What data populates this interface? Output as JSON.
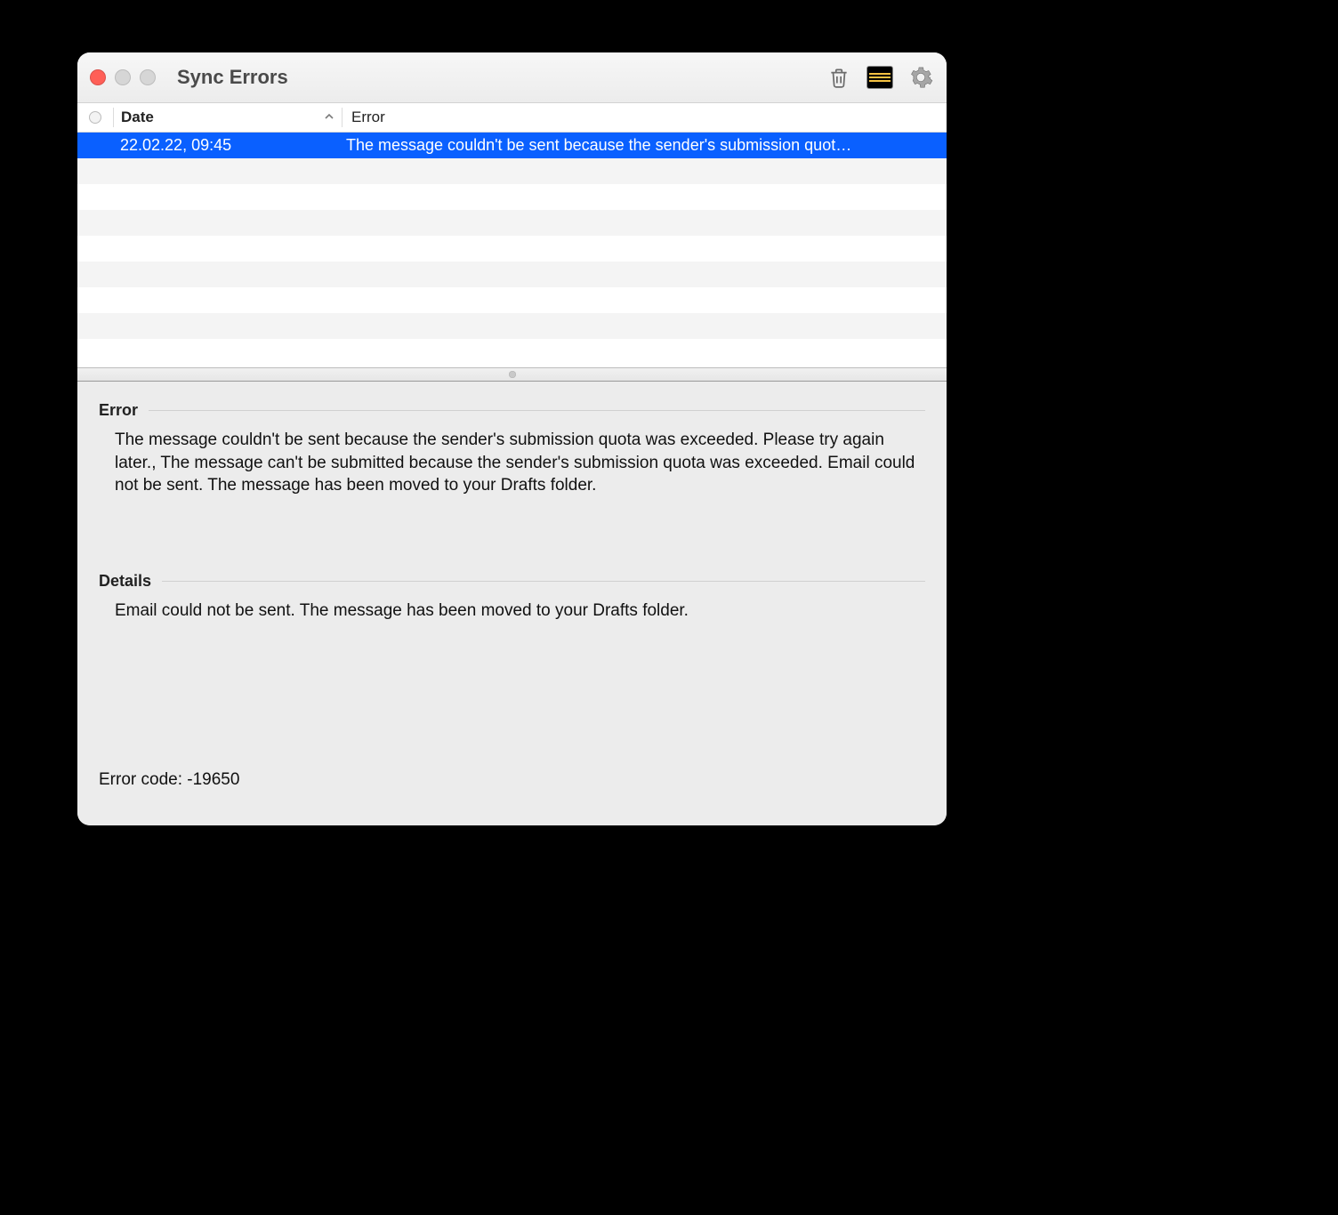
{
  "window": {
    "title": "Sync Errors"
  },
  "columns": {
    "date": "Date",
    "error": "Error"
  },
  "rows": [
    {
      "date": "22.02.22, 09:45",
      "error": "The message couldn't be sent because the sender's submission quot…",
      "selected": true
    }
  ],
  "sections": {
    "error": {
      "label": "Error",
      "body": "The message couldn't be sent because the sender's submission quota was exceeded. Please try again later., The message can't be submitted because the sender's submission quota was exceeded. Email could not be sent. The message has been moved to your Drafts folder."
    },
    "details": {
      "label": "Details",
      "body": "Email could not be sent. The message has been moved to your Drafts folder."
    }
  },
  "error_code": "Error code: -19650"
}
